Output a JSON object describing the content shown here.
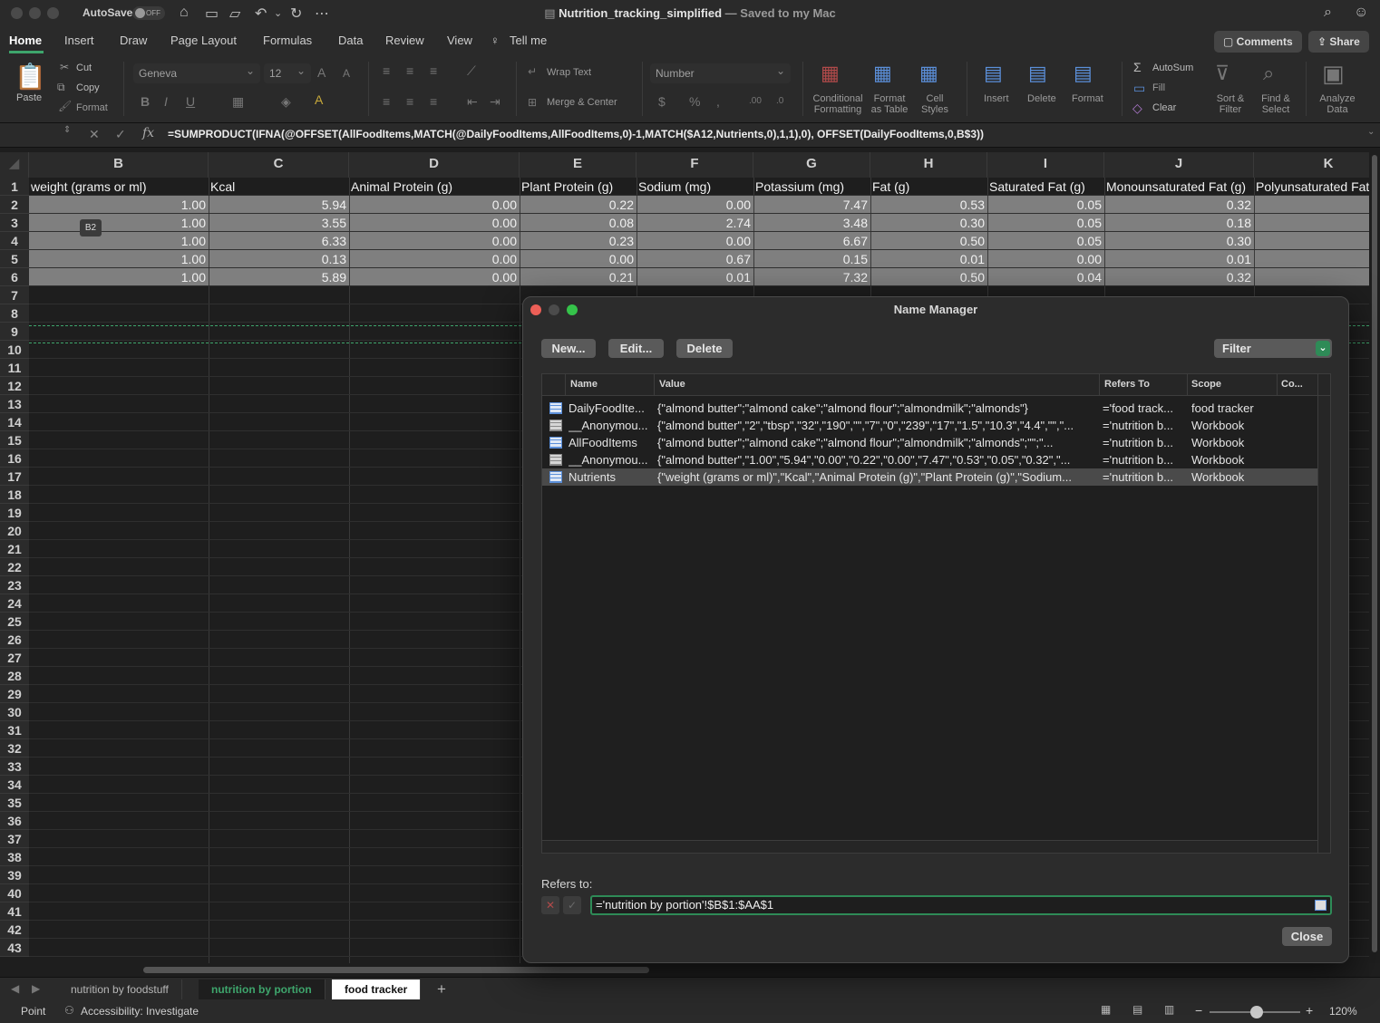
{
  "titlebar": {
    "autosave_label": "AutoSave",
    "autosave_state": "OFF",
    "doc_name": "Nutrition_tracking_simplified",
    "doc_status": "— Saved to my Mac"
  },
  "ribbon_tabs": [
    "Home",
    "Insert",
    "Draw",
    "Page Layout",
    "Formulas",
    "Data",
    "Review",
    "View"
  ],
  "tell_me": "Tell me",
  "comments_label": "Comments",
  "share_label": "Share",
  "ribbon": {
    "paste": "Paste",
    "cut": "Cut",
    "copy": "Copy",
    "format_painter": "Format",
    "font_name": "Geneva",
    "font_size": "12",
    "wrap_text": "Wrap Text",
    "merge_center": "Merge & Center",
    "number_format": "Number",
    "conditional_formatting": [
      "Conditional",
      "Formatting"
    ],
    "format_as_table": [
      "Format",
      "as Table"
    ],
    "cell_styles": [
      "Cell",
      "Styles"
    ],
    "insert": "Insert",
    "delete": "Delete",
    "format": "Format",
    "autosum": "AutoSum",
    "fill": "Fill",
    "clear": "Clear",
    "sort_filter": [
      "Sort &",
      "Filter"
    ],
    "find_select": [
      "Find &",
      "Select"
    ],
    "analyze_data": [
      "Analyze",
      "Data"
    ]
  },
  "formula_bar": {
    "fx": "fx",
    "formula": "=SUMPRODUCT(IFNA(@OFFSET(AllFoodItems,MATCH(@DailyFoodItems,AllFoodItems,0)-1,MATCH($A12,Nutrients,0),1,1),0), OFFSET(DailyFoodItems,0,B$3))"
  },
  "sheet": {
    "columns": [
      "B",
      "C",
      "D",
      "E",
      "F",
      "G",
      "H",
      "I",
      "J",
      "K"
    ],
    "header_row": [
      "weight (grams or ml)",
      "Kcal",
      "Animal Protein (g)",
      "Plant Protein (g)",
      "Sodium (mg)",
      "Potassium (mg)",
      "Fat (g)",
      "Saturated Fat (g)",
      "Monounsaturated Fat (g)",
      "Polyunsaturated Fat"
    ],
    "rows": [
      [
        "1.00",
        "5.94",
        "0.00",
        "0.22",
        "0.00",
        "7.47",
        "0.53",
        "0.05",
        "0.32"
      ],
      [
        "1.00",
        "3.55",
        "0.00",
        "0.08",
        "2.74",
        "3.48",
        "0.30",
        "0.05",
        "0.18"
      ],
      [
        "1.00",
        "6.33",
        "0.00",
        "0.23",
        "0.00",
        "6.67",
        "0.50",
        "0.05",
        "0.30"
      ],
      [
        "1.00",
        "0.13",
        "0.00",
        "0.00",
        "0.67",
        "0.15",
        "0.01",
        "0.00",
        "0.01"
      ],
      [
        "1.00",
        "5.89",
        "0.00",
        "0.21",
        "0.01",
        "7.32",
        "0.50",
        "0.04",
        "0.32"
      ]
    ],
    "row_numbers": [
      "1",
      "2",
      "3",
      "4",
      "5",
      "6",
      "7",
      "8",
      "9",
      "10",
      "11",
      "12",
      "13",
      "14",
      "15",
      "16",
      "17",
      "18",
      "19",
      "20",
      "21",
      "22",
      "23",
      "24",
      "25",
      "26",
      "27",
      "28",
      "29",
      "30",
      "31",
      "32",
      "33",
      "34",
      "35",
      "36",
      "37",
      "38",
      "39",
      "40",
      "41",
      "42",
      "43"
    ],
    "cell_tag": "B2"
  },
  "sheet_tabs": [
    "nutrition by foodstuff",
    "nutrition by portion",
    "food tracker"
  ],
  "active_sheet_tab": "nutrition by portion",
  "add_sheet": "+",
  "status": {
    "mode": "Point",
    "accessibility": "Accessibility: Investigate",
    "zoom": "120%",
    "zoom_minus": "−",
    "zoom_plus": "+"
  },
  "name_manager": {
    "title": "Name Manager",
    "new_label": "New...",
    "edit_label": "Edit...",
    "delete_label": "Delete",
    "filter_label": "Filter",
    "columns": [
      "Name",
      "Value",
      "Refers To",
      "Scope",
      "Co..."
    ],
    "rows": [
      {
        "name": "DailyFoodIte...",
        "value": "{\"almond butter\";\"almond cake\";\"almond flour\";\"almondmilk\";\"almonds\"}",
        "refers_to": "='food track...",
        "scope": "food tracker",
        "icon": "blue"
      },
      {
        "name": "__Anonymou...",
        "value": "{\"almond butter\",\"2\",\"tbsp\",\"32\",\"190\",\"\",\"7\",\"0\",\"239\",\"17\",\"1.5\",\"10.3\",\"4.4\",\"\",\"...",
        "refers_to": "='nutrition b...",
        "scope": "Workbook",
        "icon": "gray"
      },
      {
        "name": "AllFoodItems",
        "value": "{\"almond butter\";\"almond cake\";\"almond flour\";\"almondmilk\";\"almonds\";\"\";\"...",
        "refers_to": "='nutrition b...",
        "scope": "Workbook",
        "icon": "blue"
      },
      {
        "name": "__Anonymou...",
        "value": "{\"almond butter\",\"1.00\",\"5.94\",\"0.00\",\"0.22\",\"0.00\",\"7.47\",\"0.53\",\"0.05\",\"0.32\",\"...",
        "refers_to": "='nutrition b...",
        "scope": "Workbook",
        "icon": "gray"
      },
      {
        "name": "Nutrients",
        "value": "{\"weight (grams or ml)\",\"Kcal\",\"Animal Protein (g)\",\"Plant Protein (g)\",\"Sodium...",
        "refers_to": "='nutrition b...",
        "scope": "Workbook",
        "icon": "blue"
      }
    ],
    "selected_row": 4,
    "refers_to_label": "Refers to:",
    "refers_to_value": "='nutrition by portion'!$B$1:$AA$1",
    "close_label": "Close"
  }
}
